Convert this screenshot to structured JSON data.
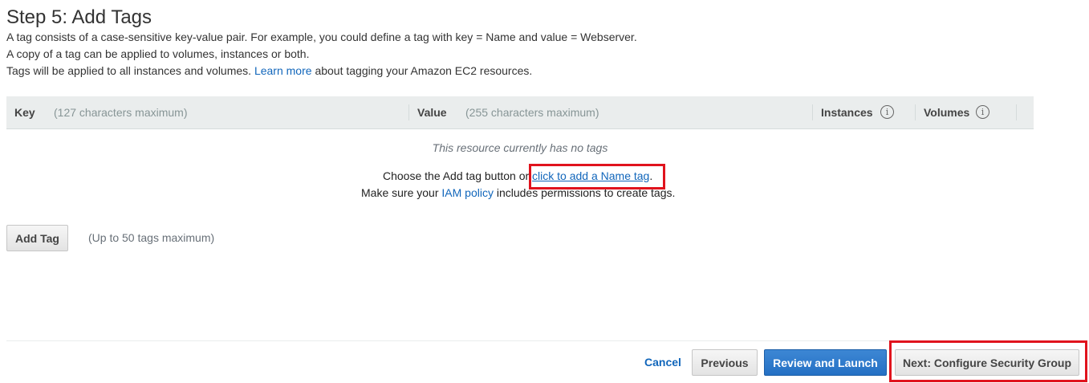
{
  "page": {
    "title": "Step 5: Add Tags",
    "desc_line1": "A tag consists of a case-sensitive key-value pair. For example, you could define a tag with key = Name and value = Webserver.",
    "desc_line2": "A copy of a tag can be applied to volumes, instances or both.",
    "desc_line3_before": "Tags will be applied to all instances and volumes.",
    "desc_line3_link": "Learn more",
    "desc_line3_after": "about tagging your Amazon EC2 resources."
  },
  "table": {
    "key_header": "Key",
    "key_hint": "(127 characters maximum)",
    "value_header": "Value",
    "value_hint": "(255 characters maximum)",
    "instances_header": "Instances",
    "volumes_header": "Volumes",
    "info_icon": "i",
    "empty_message": "This resource currently has no tags",
    "choose_before": "Choose the Add tag button or",
    "choose_link": "click to add a Name tag",
    "choose_after": ".",
    "iam_before": "Make sure your",
    "iam_link": "IAM policy",
    "iam_after": "includes permissions to create tags."
  },
  "actions": {
    "add_tag_label": "Add Tag",
    "add_tag_hint": "(Up to 50 tags maximum)",
    "cancel_label": "Cancel",
    "previous_label": "Previous",
    "review_label": "Review and Launch",
    "next_label": "Next: Configure Security Group"
  },
  "colors": {
    "link": "#1166bb",
    "primary_button": "#2470c4",
    "highlight": "#e0131d",
    "header_bg": "#eaeded"
  },
  "icons": {
    "info": "info-circle-icon"
  }
}
